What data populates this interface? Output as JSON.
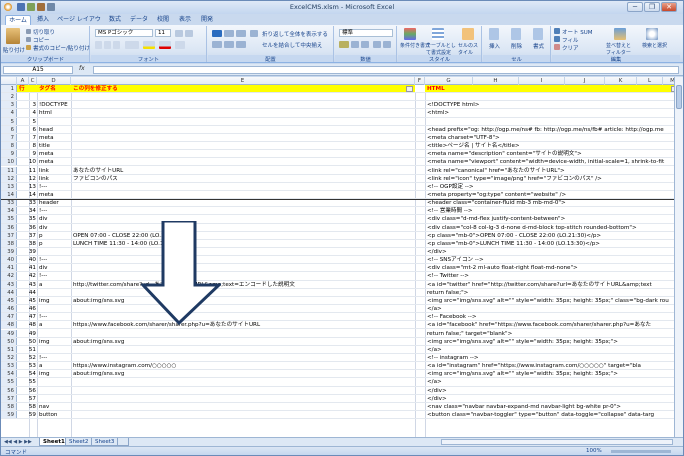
{
  "window": {
    "title": "ExcelCMS.xlsm - Microsoft Excel",
    "minimize": "─",
    "restore": "❐",
    "close": "✕"
  },
  "tabs": [
    "ホーム",
    "挿入",
    "ページ レイアウト",
    "数式",
    "データ",
    "校閲",
    "表示",
    "開発"
  ],
  "ribbon": {
    "paste": "貼り付け",
    "cut": "切り取り",
    "copy": "コピー",
    "format_painter": "書式のコピー/貼り付け",
    "clipboard": "クリップボード",
    "font_name": "MS Pゴシック",
    "font_size": "11",
    "font": "フォント",
    "wrap_text": "折り返して全体を表示する",
    "merge_center": "セルを結合して中央揃え",
    "alignment": "配置",
    "number_format": "標準",
    "number": "数値",
    "conditional_format": "条件付き書式",
    "format_as_table": "テーブルとして書式設定",
    "cell_styles": "セルのスタイル",
    "styles": "スタイル",
    "insert": "挿入",
    "delete": "削除",
    "format": "書式",
    "cells": "セル",
    "autosum": "オート SUM",
    "fill": "フィル",
    "clear": "クリア",
    "sort_filter": "並べ替えとフィルター",
    "find_select": "検索と選択",
    "editing": "編集"
  },
  "formula_bar": {
    "name_box": "A15",
    "fx": "fx",
    "formula": ""
  },
  "columns": [
    "A",
    "C",
    "D",
    "E",
    "F",
    "G",
    "H",
    "I",
    "J",
    "K",
    "L",
    "M"
  ],
  "header_row": {
    "row": "1",
    "a": "行",
    "d": "タグ名",
    "e": "この列を修正する",
    "g": "HTML"
  },
  "rows": [
    {
      "n": "2",
      "a": "",
      "d": "",
      "e": "",
      "g": ""
    },
    {
      "n": "3",
      "a": "3",
      "d": "!DOCTYPE",
      "e": "",
      "g": "<!DOCTYPE html>"
    },
    {
      "n": "4",
      "a": "4",
      "d": "html",
      "e": "",
      "g": "<html>"
    },
    {
      "n": "5",
      "a": "5",
      "d": "",
      "e": "",
      "g": ""
    },
    {
      "n": "6",
      "a": "6",
      "d": "head",
      "e": "",
      "g": "<head prefix=\"og: http://ogp.me/ns# fb: http://ogp.me/ns/fb# article: http://ogp.me"
    },
    {
      "n": "7",
      "a": "7",
      "d": "meta",
      "e": "",
      "g": "<meta charset=\"UTF-8\">"
    },
    {
      "n": "8",
      "a": "8",
      "d": "title",
      "e": "",
      "g": "<title>ページ名 | サイト名</title>"
    },
    {
      "n": "9",
      "a": "9",
      "d": "meta",
      "e": "",
      "g": "<meta name=\"description\" content=\"サイトの説明文\">"
    },
    {
      "n": "10",
      "a": "10",
      "d": "meta",
      "e": "",
      "g": "<meta name=\"viewport\" content=\"width=device-width, initial-scale=1, shrink-to-fit"
    },
    {
      "n": "11",
      "a": "11",
      "d": "link",
      "e": "あなたのサイトURL",
      "g": "<link rel=\"canonical\" href=\"あなたのサイトURL\">"
    },
    {
      "n": "12",
      "a": "12",
      "d": "link",
      "e": "ファビコンのパス",
      "g": "<link rel=\"icon\" type=\"image/png\" href=\"ファビコンのパス\" />"
    },
    {
      "n": "13",
      "a": "13",
      "d": "!---",
      "e": "",
      "g": "<!-- OGP設定 -->"
    },
    {
      "n": "14",
      "a": "14",
      "d": "meta",
      "e": "",
      "g": "<meta property=\"og:type\" content=\"website\" />"
    },
    {
      "n": "33",
      "a": "33",
      "d": "header",
      "e": "",
      "g": "<header class=\"container-fluid mb-3 mb-md-0\">"
    },
    {
      "n": "34",
      "a": "34",
      "d": "!---",
      "e": "",
      "g": "<!-- 営業時間 -->"
    },
    {
      "n": "35",
      "a": "35",
      "d": "div",
      "e": "",
      "g": "<div class=\"d-md-flex justify-content-between\">"
    },
    {
      "n": "36",
      "a": "36",
      "d": "div",
      "e": "",
      "g": "<div class=\"col-8 col-lg-3 d-none d-md-block top-stitch rounded-bottom\">"
    },
    {
      "n": "37",
      "a": "37",
      "d": "p",
      "e": "OPEN 07:00 - CLOSE 22:00 (LO.21:30)",
      "g": "<p class=\"mb-0\">OPEN 07:00 - CLOSE 22:00 (LO.21:30)</p>"
    },
    {
      "n": "38",
      "a": "38",
      "d": "p",
      "e": "LUNCH TIME 11:30 - 14:00 (LO.13:30)",
      "g": "<p class=\"mb-0\">LUNCH TIME 11:30 - 14:00 (LO.13:30)</p>"
    },
    {
      "n": "39",
      "a": "39",
      "d": "",
      "e": "",
      "g": "</div>"
    },
    {
      "n": "40",
      "a": "40",
      "d": "!---",
      "e": "",
      "g": "<!-- SNSアイコン -->"
    },
    {
      "n": "41",
      "a": "41",
      "d": "div",
      "e": "",
      "g": "<div class=\"mt-2 ml-auto float-right float-md-none\">"
    },
    {
      "n": "42",
      "a": "42",
      "d": "!---",
      "e": "",
      "g": "<!-- Twitter -->"
    },
    {
      "n": "43",
      "a": "43",
      "d": "a",
      "e": "http://twitter.com/share?url=あなたのサイトURL&amp;text=エンコードした説明文",
      "g": "<a id=\"twitter\" href=\"http://twitter.com/share?url=あなたのサイトURL&amp;text"
    },
    {
      "n": "44",
      "a": "44",
      "d": "",
      "e": "",
      "g": "return false;\">"
    },
    {
      "n": "45",
      "a": "45",
      "d": "img",
      "e": "about:img/sns.svg",
      "g": "<img src=\"img/sns.svg\" alt=\"\" style=\"width: 35px; height: 35px;\" class=\"bg-dark rou"
    },
    {
      "n": "46",
      "a": "46",
      "d": "",
      "e": "",
      "g": "</a>"
    },
    {
      "n": "47",
      "a": "47",
      "d": "!---",
      "e": "",
      "g": "<!-- Facebook -->"
    },
    {
      "n": "48",
      "a": "48",
      "d": "a",
      "e": "https://www.facebook.com/sharer/sharer.php?u=あなたのサイトURL",
      "g": "<a id=\"facebook\" href=\"https://www.facebook.com/sharer/sharer.php?u=あなた"
    },
    {
      "n": "49",
      "a": "49",
      "d": "",
      "e": "",
      "g": "return false;\" target=\"blank\">"
    },
    {
      "n": "50",
      "a": "50",
      "d": "img",
      "e": "about:img/sns.svg",
      "g": "<img src=\"img/sns.svg\" alt=\"\" style=\"width: 35px; height: 35px;\">"
    },
    {
      "n": "51",
      "a": "51",
      "d": "",
      "e": "",
      "g": "</a>"
    },
    {
      "n": "52",
      "a": "52",
      "d": "!---",
      "e": "",
      "g": "<!-- instagram -->"
    },
    {
      "n": "53",
      "a": "53",
      "d": "a",
      "e": "https://www.instagram.com/○○○○○",
      "g": "<a id=\"instagram\" href=\"https://www.instagram.com/○○○○○\" target=\"bla"
    },
    {
      "n": "54",
      "a": "54",
      "d": "img",
      "e": "about:img/sns.svg",
      "g": "<img src=\"img/sns.svg\" alt=\"\" style=\"width: 35px; height: 35px;\">"
    },
    {
      "n": "55",
      "a": "55",
      "d": "",
      "e": "",
      "g": "</a>"
    },
    {
      "n": "56",
      "a": "56",
      "d": "",
      "e": "",
      "g": "</div>"
    },
    {
      "n": "57",
      "a": "57",
      "d": "",
      "e": "",
      "g": "</div>"
    },
    {
      "n": "58",
      "a": "58",
      "d": "nav",
      "e": "",
      "g": "<nav class=\"navbar navbar-expand-md navbar-light bg-white pr-0\">"
    },
    {
      "n": "59",
      "a": "59",
      "d": "button",
      "e": "",
      "g": "<button class=\"navbar-toggler\" type=\"button\" data-toggle=\"collapse\" data-targ"
    }
  ],
  "sheets": [
    "Sheet1",
    "Sheet2",
    "Sheet3"
  ],
  "status": {
    "mode": "コマンド",
    "zoom": "100%"
  },
  "colors": {
    "header_fill": "#ffff00",
    "header_text": "#ff0000",
    "arrow_stroke": "#1f3a63"
  }
}
